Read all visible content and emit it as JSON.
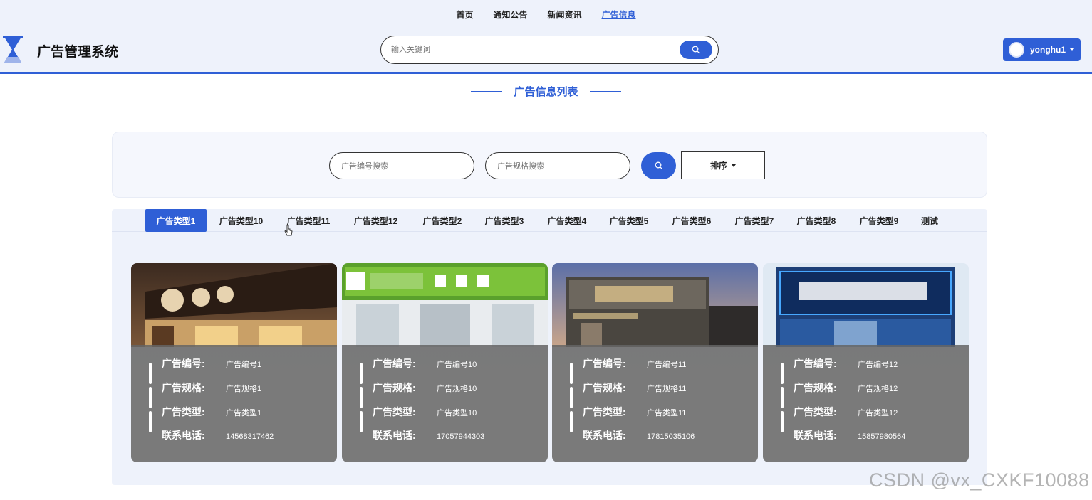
{
  "nav": {
    "items": [
      "首页",
      "通知公告",
      "新闻资讯",
      "广告信息"
    ],
    "active_index": 3
  },
  "header": {
    "title": "广告管理系统",
    "search_placeholder": "输入关键词",
    "username": "yonghu1"
  },
  "section": {
    "title": "广告信息列表"
  },
  "filters": {
    "code_placeholder": "广告编号搜索",
    "spec_placeholder": "广告规格搜索",
    "sort_label": "排序"
  },
  "tabs": [
    "广告类型1",
    "广告类型10",
    "广告类型11",
    "广告类型12",
    "广告类型2",
    "广告类型3",
    "广告类型4",
    "广告类型5",
    "广告类型6",
    "广告类型7",
    "广告类型8",
    "广告类型9",
    "测试"
  ],
  "tabs_active_index": 0,
  "field_labels": {
    "code": "广告编号:",
    "spec": "广告规格:",
    "type": "广告类型:",
    "phone": "联系电话:"
  },
  "cards": [
    {
      "code": "广告编号1",
      "spec": "广告规格1",
      "type": "广告类型1",
      "phone": "14568317462"
    },
    {
      "code": "广告编号10",
      "spec": "广告规格10",
      "type": "广告类型10",
      "phone": "17057944303"
    },
    {
      "code": "广告编号11",
      "spec": "广告规格11",
      "type": "广告类型11",
      "phone": "17815035106"
    },
    {
      "code": "广告编号12",
      "spec": "广告规格12",
      "type": "广告类型12",
      "phone": "15857980564"
    }
  ],
  "watermark": "CSDN @vx_CXKF10088",
  "colors": {
    "accent": "#2f5fd6",
    "header_bg": "#eef2fb",
    "card_info_bg": "#7a7a7a"
  }
}
